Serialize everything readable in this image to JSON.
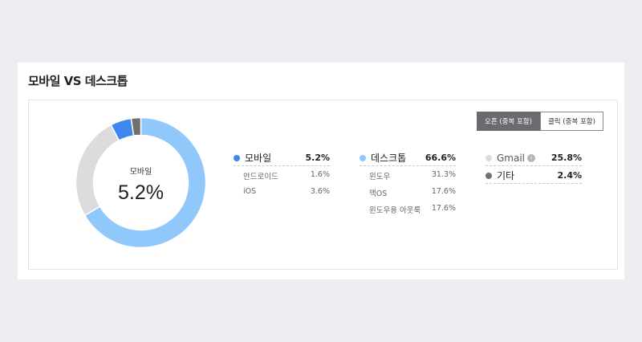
{
  "section": {
    "title": "모바일 VS 데스크톱"
  },
  "toggle": {
    "opens_label": "오픈 (중복 포함)",
    "clicks_label": "클릭 (중복 포함)",
    "active": "opens"
  },
  "donut": {
    "center_label": "모바일",
    "center_value": "5.2%"
  },
  "colors": {
    "mobile": "#3f86ee",
    "desktop": "#90c8fc",
    "gmail": "#dcdcdf",
    "other": "#707070"
  },
  "chart_data": {
    "type": "pie",
    "categories": [
      "데스크톱",
      "Gmail",
      "모바일",
      "기타"
    ],
    "values": [
      66.6,
      25.8,
      5.2,
      2.4
    ]
  },
  "mobile": {
    "label": "모바일",
    "pct": "5.2%",
    "items": [
      {
        "label": "안드로이드",
        "pct": "1.6%"
      },
      {
        "label": "iOS",
        "pct": "3.6%"
      }
    ]
  },
  "desktop": {
    "label": "데스크톱",
    "pct": "66.6%",
    "items": [
      {
        "label": "윈도우",
        "pct": "31.3%"
      },
      {
        "label": "맥OS",
        "pct": "17.6%"
      },
      {
        "label": "윈도우용 아웃룩",
        "pct": "17.6%"
      }
    ]
  },
  "gmail": {
    "label": "Gmail",
    "pct": "25.8%",
    "info_icon": "info-icon"
  },
  "other": {
    "label": "기타",
    "pct": "2.4%"
  }
}
